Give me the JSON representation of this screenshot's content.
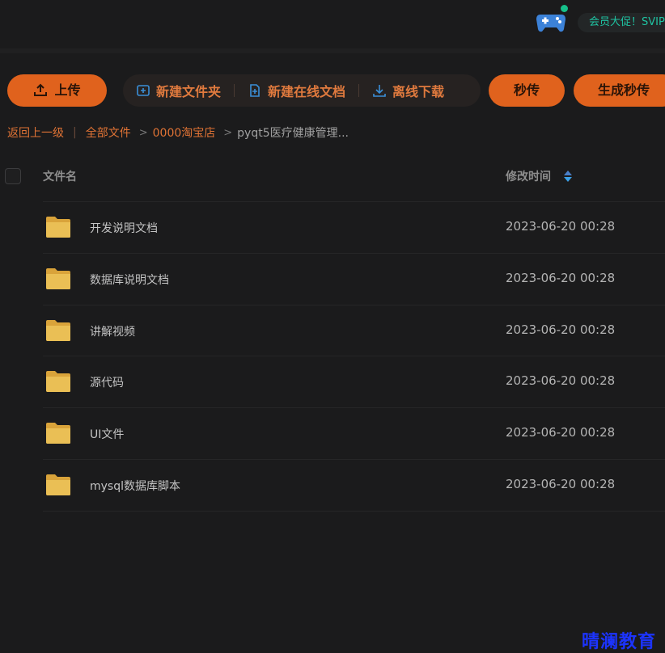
{
  "header": {
    "vip_text": "会员大促！SVIP"
  },
  "toolbar": {
    "upload_label": "上传",
    "new_folder_label": "新建文件夹",
    "new_doc_label": "新建在线文档",
    "offline_download_label": "离线下载",
    "instant_upload_label": "秒传",
    "generate_instant_label": "生成秒传"
  },
  "breadcrumb": {
    "back_label": "返回上一级",
    "separator": "|",
    "arrow": ">",
    "items": [
      "全部文件",
      "0000淘宝店"
    ],
    "current": "pyqt5医疗健康管理..."
  },
  "table": {
    "columns": {
      "name": "文件名",
      "modified": "修改时间"
    },
    "rows": [
      {
        "name": "开发说明文档",
        "modified": "2023-06-20 00:28",
        "icon": "folder-icon"
      },
      {
        "name": "数据库说明文档",
        "modified": "2023-06-20 00:28",
        "icon": "folder-icon"
      },
      {
        "name": "讲解视频",
        "modified": "2023-06-20 00:28",
        "icon": "folder-icon"
      },
      {
        "name": "源代码",
        "modified": "2023-06-20 00:28",
        "icon": "folder-icon"
      },
      {
        "name": "UI文件",
        "modified": "2023-06-20 00:28",
        "icon": "folder-icon"
      },
      {
        "name": "mysql数据库脚本",
        "modified": "2023-06-20 00:28",
        "icon": "folder-icon"
      }
    ]
  },
  "watermark": "晴澜教育",
  "colors": {
    "background": "#1b1b1c",
    "accent": "#e0621d",
    "link": "#e07335",
    "vip_text": "#1fc3a2",
    "folder": "#e8b84a",
    "watermark": "#1c34ff"
  }
}
